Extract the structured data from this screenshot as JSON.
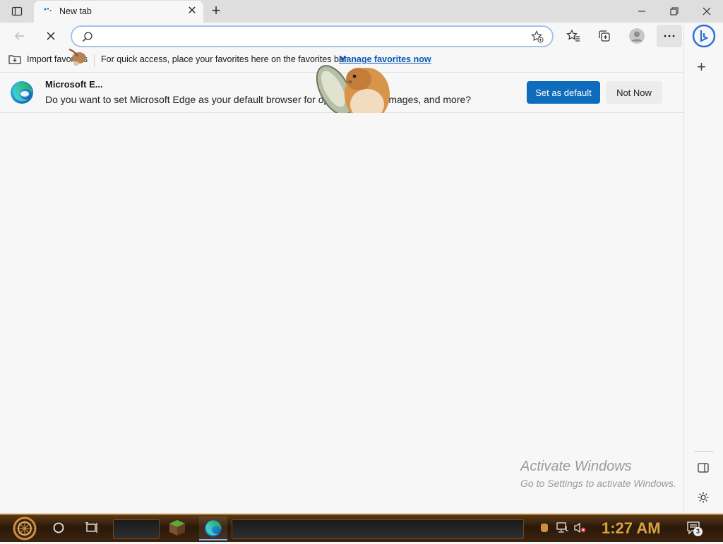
{
  "browser": {
    "tab": {
      "title": "New tab",
      "close_label": "✕"
    },
    "window_controls": {
      "minimize": "—",
      "restore": "❐",
      "close": "✕"
    },
    "new_tab_label": "+",
    "address": {
      "value": "",
      "placeholder": ""
    }
  },
  "favorites_bar": {
    "import_label": "Import favorites",
    "hint": "For quick access, place your favorites here on the favorites bar.",
    "manage_link": "Manage favorites now"
  },
  "infobar": {
    "title": "Microsoft E...",
    "message": "Do you want to set Microsoft Edge as your default browser for opening PDFs, images, and more?",
    "primary_button": "Set as default",
    "secondary_button": "Not Now"
  },
  "watermark": {
    "line1": "Activate Windows",
    "line2": "Go to Settings to activate Windows."
  },
  "taskbar": {
    "time": "1:27 AM",
    "notification_count": "3"
  },
  "colors": {
    "accent": "#0f6cbd",
    "link": "#0a5ab8",
    "clock": "#d9a441"
  }
}
